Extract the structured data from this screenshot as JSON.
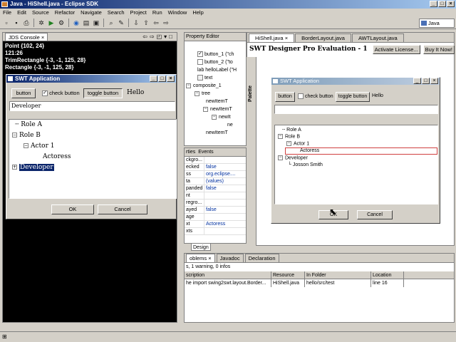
{
  "window": {
    "title": "Java - HiShell.java - Eclipse SDK"
  },
  "menu": [
    "File",
    "Edit",
    "Source",
    "Refactor",
    "Navigate",
    "Search",
    "Project",
    "Run",
    "Window",
    "Help"
  ],
  "perspective": {
    "label": "Java"
  },
  "console": {
    "tab_label": "JDS Console",
    "lines": [
      "Point {102, 24}",
      "121:26",
      "TrimRectangle {-3, -1, 125, 28}",
      "Rectangle {-3, -1, 125, 28}"
    ]
  },
  "swt_app": {
    "title": "SWT Application",
    "button_label": "button",
    "check_label": "check button",
    "toggle_label": "toggle button",
    "hello_label": "Hello",
    "text_value": "Developer",
    "tree": [
      "Role A",
      "Role B",
      "Actor 1",
      "Actoress",
      "Developer"
    ],
    "ok_label": "OK",
    "cancel_label": "Cancel"
  },
  "property_editor": {
    "title": "Property Editor",
    "items": [
      "button_1 (\"ch",
      "button_2 (\"to",
      "lab helloLabel (\"H",
      "text",
      "composite_1",
      "tree",
      "newItemT",
      "newItemT",
      "newIt",
      "ne",
      "newItemT"
    ]
  },
  "properties": {
    "tabs": [
      "rties",
      "Events"
    ],
    "rows": [
      {
        "k": "ckgro...",
        "v": ""
      },
      {
        "k": "ecked",
        "v": "false"
      },
      {
        "k": "ss",
        "v": "org.eclipse...."
      },
      {
        "k": "ta",
        "v": "(values)"
      },
      {
        "k": "panded",
        "v": "false"
      },
      {
        "k": "nt",
        "v": ""
      },
      {
        "k": "regro...",
        "v": ""
      },
      {
        "k": "ayed",
        "v": "false"
      },
      {
        "k": "age",
        "v": ""
      },
      {
        "k": "xt",
        "v": "Actoress"
      },
      {
        "k": "xts",
        "v": ""
      }
    ],
    "design_tab": "Design"
  },
  "editor": {
    "tabs": [
      "HiShell.java",
      "BorderLayout.java",
      "AWTLayout.java"
    ],
    "eval_text": "SWT Designer Pro Evaluation - 1",
    "license_label": "Activate License...",
    "buy_label": "Buy It Now!",
    "palette_label": "Palette"
  },
  "design_preview": {
    "title": "SWT Application",
    "button_label": "button",
    "check_label": "check button",
    "toggle_label": "toggle button",
    "hello_label": "Hello",
    "tree": [
      "Role A",
      "Role B",
      "Actor 1",
      "Actoress",
      "Developer",
      "Josson Smith"
    ],
    "ok_label": "OK",
    "cancel_label": "Cancel"
  },
  "problems": {
    "tabs": [
      "oblems",
      "Javadoc",
      "Declaration"
    ],
    "summary": "s, 1 warning, 0 infos",
    "columns": [
      "scription",
      "Resource",
      "In Folder",
      "Location"
    ],
    "rows": [
      {
        "desc": "he import swing2swt.layout.Border...",
        "resource": "HiShell.java",
        "folder": "hello/src/test",
        "location": "line 16"
      }
    ]
  }
}
